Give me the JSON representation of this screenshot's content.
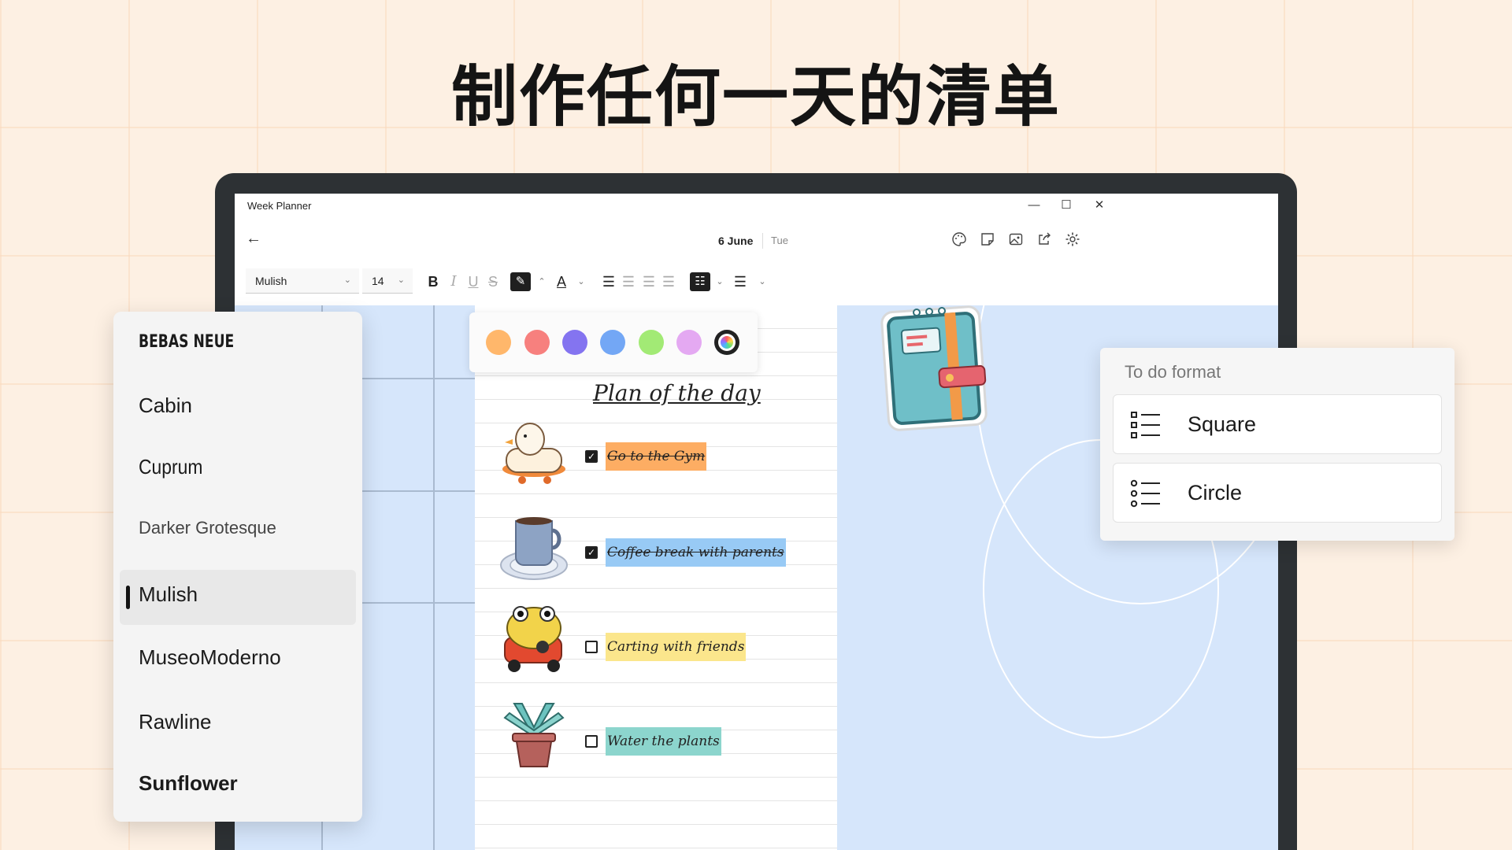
{
  "headline": "制作任何一天的清单",
  "window": {
    "title": "Week Planner",
    "minimize_glyph": "—",
    "maximize_glyph": "☐",
    "close_glyph": "✕"
  },
  "header": {
    "back_glyph": "←",
    "date": "6 June",
    "day": "Tue",
    "icons": [
      "palette-icon",
      "sticky-note-icon",
      "image-icon",
      "share-icon",
      "settings-icon"
    ]
  },
  "toolbar": {
    "font": "Mulish",
    "size": "14",
    "bold": "B",
    "italic": "I",
    "underline": "U",
    "strike": "S",
    "font_color": "A"
  },
  "swatches": {
    "colors": [
      "#ffb76b",
      "#f7807e",
      "#8474f0",
      "#73a7f5",
      "#a2ea75",
      "#e4a9f2"
    ]
  },
  "font_panel": {
    "fonts": [
      "BEBAS NEUE",
      "Cabin",
      "Cuprum",
      "Darker Grotesque",
      "Mulish",
      "MuseoModerno",
      "Rawline",
      "Sunflower"
    ],
    "selected": "Mulish"
  },
  "plan": {
    "title": "Plan of the day",
    "tasks": [
      {
        "label": "Go to the Gym",
        "checked": true,
        "highlight": "#fdad63",
        "sticker": "duck-sticker"
      },
      {
        "label": "Coffee break with parents",
        "checked": true,
        "highlight": "#98caf5",
        "sticker": "coffee-cup-sticker"
      },
      {
        "label": "Carting with friends",
        "checked": false,
        "highlight": "#fbe68c",
        "sticker": "frog-car-sticker"
      },
      {
        "label": "Water the plants",
        "checked": false,
        "highlight": "#8cd5cd",
        "sticker": "plant-sticker"
      }
    ]
  },
  "todo_format": {
    "title": "To do format",
    "options": [
      "Square",
      "Circle"
    ]
  }
}
